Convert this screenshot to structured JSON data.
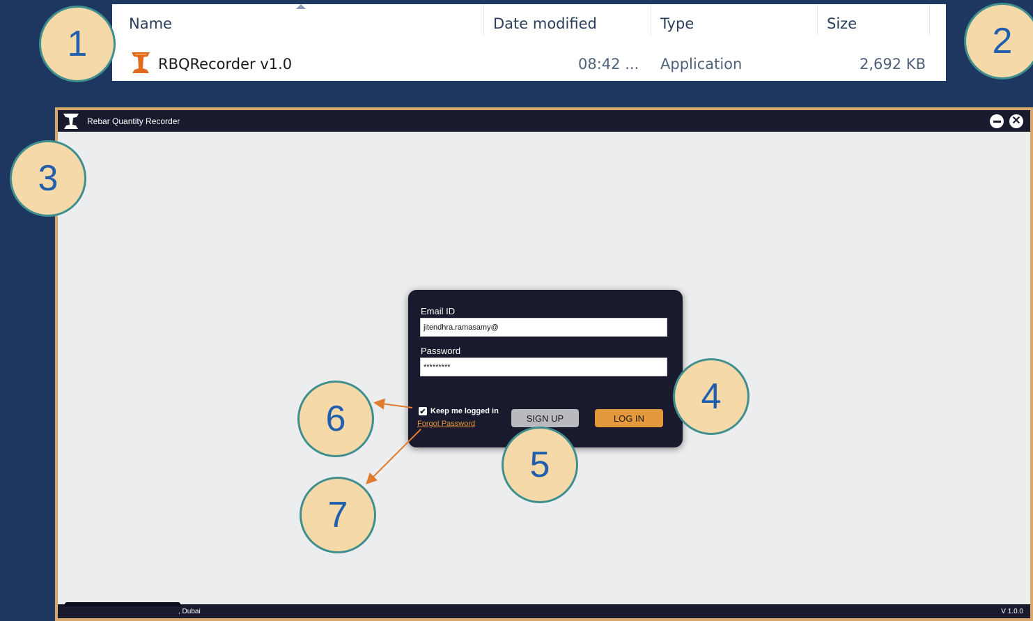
{
  "explorer": {
    "columns": {
      "name": "Name",
      "date_modified": "Date modified",
      "type": "Type",
      "size": "Size"
    },
    "file": {
      "icon": "rebar-app-icon",
      "name": "RBQRecorder v1.0",
      "date_modified": "08:42 ...",
      "type": "Application",
      "size": "2,692 KB"
    }
  },
  "annotations": [
    "1",
    "2",
    "3",
    "4",
    "5",
    "6",
    "7"
  ],
  "window": {
    "title": "Rebar Quantity Recorder",
    "controls": {
      "minimize_icon": "minus-circle-icon",
      "close_icon": "close-circle-icon"
    }
  },
  "login": {
    "email_label": "Email ID",
    "email_value": "jitendhra.ramasamy@",
    "password_label": "Password",
    "password_value": "*********",
    "remember_label": "Keep me logged in",
    "remember_checked": true,
    "forgot_label": "Forgot Password",
    "signup_label": "SIGN UP",
    "login_label": "LOG IN"
  },
  "statusbar": {
    "location": ", Dubai",
    "version": "V 1.0.0"
  },
  "colors": {
    "background": "#1e3760",
    "window_border": "#d8a86a",
    "dark": "#191a2d",
    "accent_orange": "#e4993d",
    "badge_fill": "#f5d9a8",
    "badge_text": "#1f5fae",
    "arrow": "#e07b30"
  }
}
